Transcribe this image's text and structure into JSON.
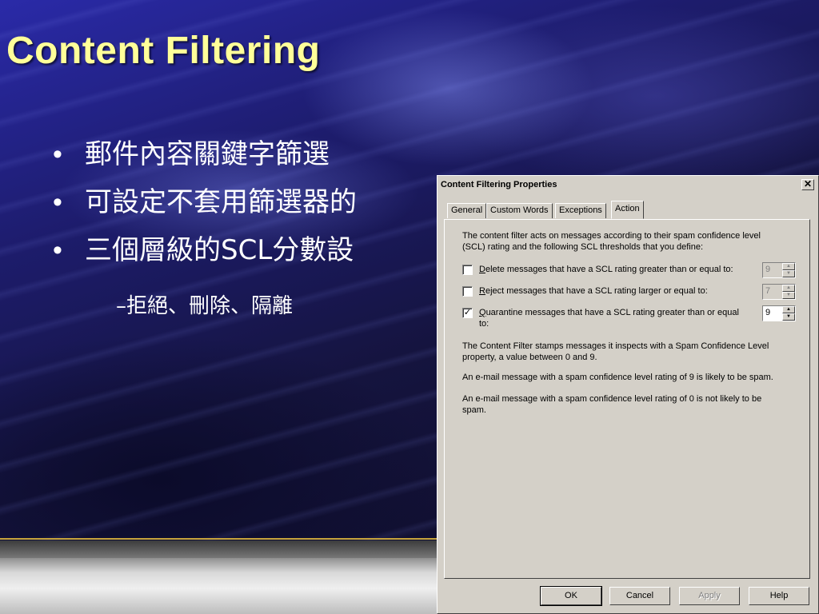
{
  "slide": {
    "title": "Content Filtering",
    "bullets": [
      {
        "marker": "•",
        "text": "郵件內容關鍵字篩選"
      },
      {
        "marker": "•",
        "text": "可設定不套用篩選器的"
      },
      {
        "marker": "•",
        "text": "三個層級的SCL分數設"
      }
    ],
    "sub_bullet": "–拒絕、刪除、隔離",
    "colors": {
      "title": "#ffff99",
      "background": "#1d1c6c",
      "accent_line": "#c8a43c"
    }
  },
  "dialog": {
    "title": "Content Filtering Properties",
    "close_glyph": "✕",
    "tabs": [
      {
        "label": "General",
        "active": false
      },
      {
        "label": "Custom Words",
        "active": false
      },
      {
        "label": "Exceptions",
        "active": false
      },
      {
        "label": "Action",
        "active": true
      }
    ],
    "intro": "The content filter acts on messages according to their spam confidence level (SCL) rating and the following SCL thresholds that you define:",
    "options": [
      {
        "accel": "D",
        "label_rest": "elete messages that have a SCL rating greater than or equal to:",
        "checked": false,
        "check_glyph": "",
        "value": "9",
        "enabled": false
      },
      {
        "accel": "R",
        "label_rest": "eject messages that have a SCL rating larger or equal to:",
        "checked": false,
        "check_glyph": "",
        "value": "7",
        "enabled": false
      },
      {
        "accel": "Q",
        "label_rest": "uarantine messages that have a SCL rating greater than or equal to:",
        "checked": true,
        "check_glyph": "✓",
        "value": "9",
        "enabled": true
      }
    ],
    "spin_up_glyph": "▲",
    "spin_down_glyph": "▼",
    "info": [
      "The Content Filter stamps messages it inspects with a Spam Confidence Level property, a value between 0 and 9.",
      "An e-mail message with a spam confidence level rating of 9 is likely to be spam.",
      "An e-mail message with a spam confidence level rating of 0 is not likely to be spam."
    ],
    "buttons": {
      "ok": "OK",
      "cancel": "Cancel",
      "apply": "Apply",
      "help": "Help"
    }
  }
}
